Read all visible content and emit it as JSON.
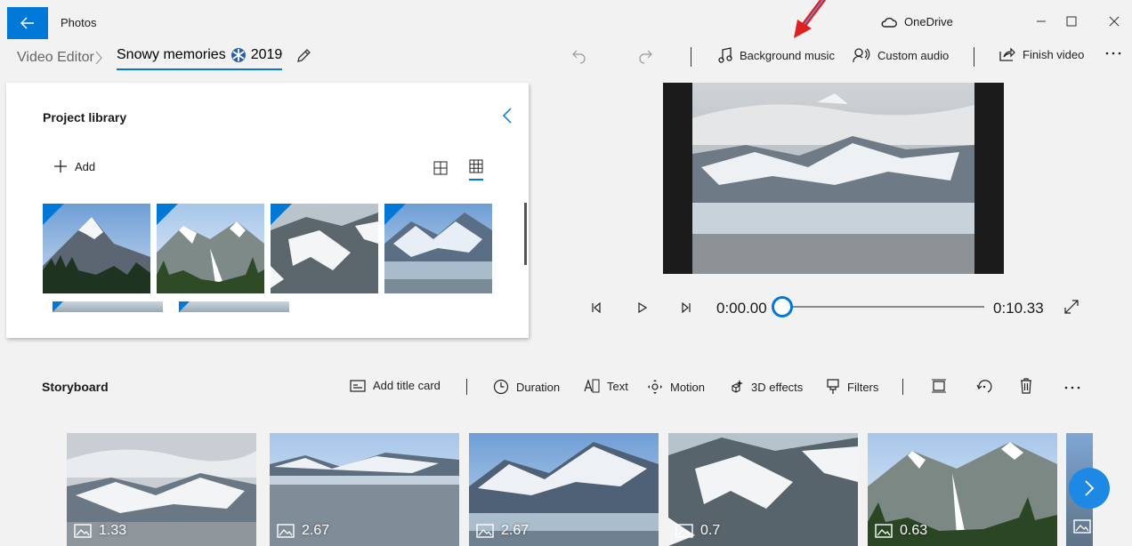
{
  "app": {
    "title": "Photos",
    "onedrive_label": "OneDrive"
  },
  "breadcrumb": {
    "home": "Video Editor",
    "project_name": "Snowy memories",
    "project_year": "2019"
  },
  "toolbar": {
    "background_music": "Background music",
    "custom_audio": "Custom audio",
    "finish_video": "Finish video"
  },
  "library": {
    "title": "Project library",
    "add_label": "Add"
  },
  "playback": {
    "current_time": "0:00.00",
    "total_time": "0:10.33",
    "progress": 0.0
  },
  "storyboard": {
    "title": "Storyboard",
    "tools": {
      "add_title_card": "Add title card",
      "duration": "Duration",
      "text": "Text",
      "motion": "Motion",
      "effects_3d": "3D effects",
      "filters": "Filters"
    },
    "clips": [
      {
        "duration": "1.33"
      },
      {
        "duration": "2.67"
      },
      {
        "duration": "2.67"
      },
      {
        "duration": "0.7"
      },
      {
        "duration": "0.63"
      }
    ]
  },
  "colors": {
    "accent": "#0078d7",
    "annotation_arrow": "#e02020"
  }
}
